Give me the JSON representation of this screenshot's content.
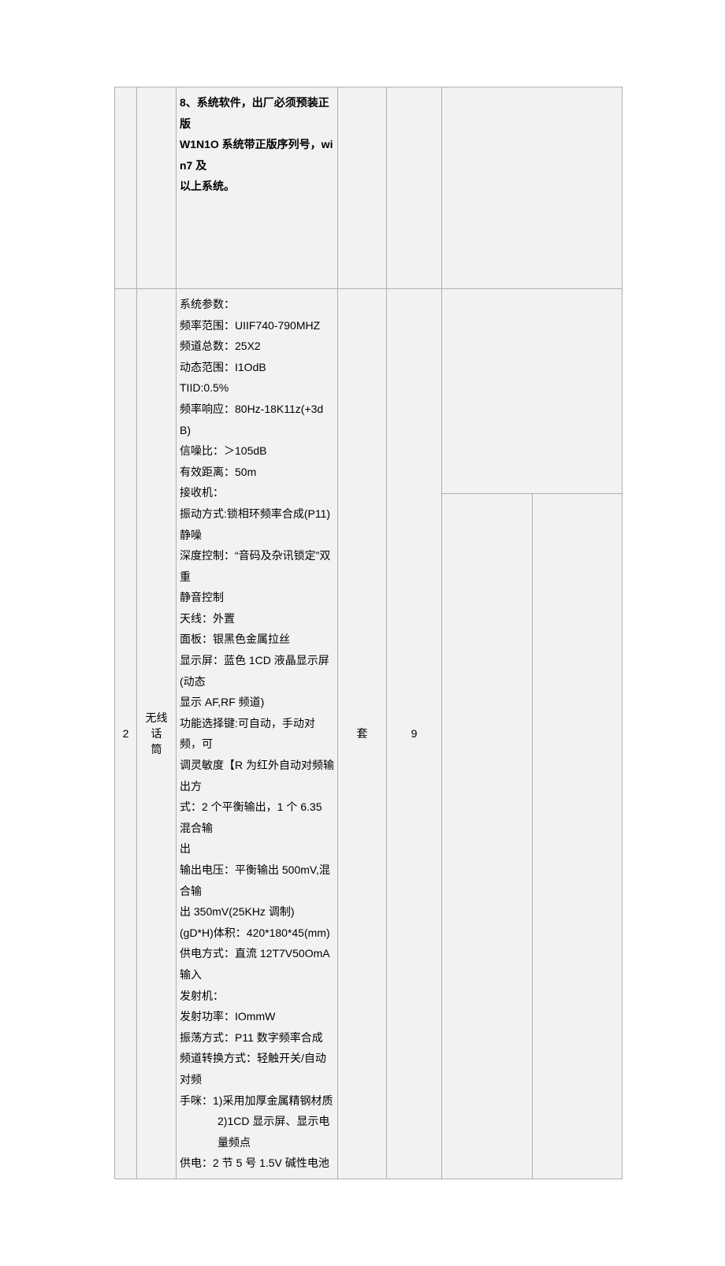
{
  "row1": {
    "spec_lines": [
      {
        "text": "8、系统软件，出厂必须预装正版",
        "bold": true
      },
      {
        "text": "W1N1O 系统带正版序列号，win7 及",
        "bold": true
      },
      {
        "text": "以上系统。",
        "bold": true
      }
    ]
  },
  "row2": {
    "index": "2",
    "name_line1": "无线话",
    "name_line2": "筒",
    "unit": "套",
    "qty": "9",
    "spec_lines": [
      {
        "text": "系统参数："
      },
      {
        "text": "频率范围：UIIF740-790MHZ"
      },
      {
        "text": "频道总数：25X2"
      },
      {
        "text": "动态范围：I1OdB"
      },
      {
        "text": "TIID:0.5%"
      },
      {
        "text": "频率响应：80Hz-18K11z(+3dB)"
      },
      {
        "text": "信噪比：＞105dB"
      },
      {
        "text": "有效距离：50m"
      },
      {
        "text": "接收机："
      },
      {
        "text": "振动方式:锁相环频率合成(P11)静噪"
      },
      {
        "text": "深度控制：“音码及杂讯锁定”双重"
      },
      {
        "text": "静音控制"
      },
      {
        "text": "天线：外置"
      },
      {
        "text": "面板：银黑色金属拉丝"
      },
      {
        "text": "显示屏：蓝色 1CD 液晶显示屏(动态"
      },
      {
        "text": "显示 AF,RF 频道)"
      },
      {
        "text": "功能选择键:可自动，手动对频，可"
      },
      {
        "text": "调灵敏度【R 为红外自动对频输出方"
      },
      {
        "text": "式：2 个平衡输出，1 个 6.35 混合输"
      },
      {
        "text": "出"
      },
      {
        "text": "输出电压：平衡输出 500mV,混合输"
      },
      {
        "text": "出 350mV(25KHz 调制)"
      },
      {
        "text": "(gD*H)体积：420*180*45(mm)"
      },
      {
        "text": "供电方式：直流 12T7V50OmA 输入"
      },
      {
        "text": "发射机："
      },
      {
        "text": "发射功率：IOmmW"
      },
      {
        "text": "振荡方式：P11 数字频率合成"
      },
      {
        "text": "频道转换方式：轻触开关/自动对频"
      },
      {
        "text": "手咪：1)采用加厚金属精钢材质"
      },
      {
        "text": "2)1CD 显示屏、显示电量频点",
        "indent2": true
      },
      {
        "text": "供电：2 节 5 号 1.5V 碱性电池"
      }
    ]
  }
}
